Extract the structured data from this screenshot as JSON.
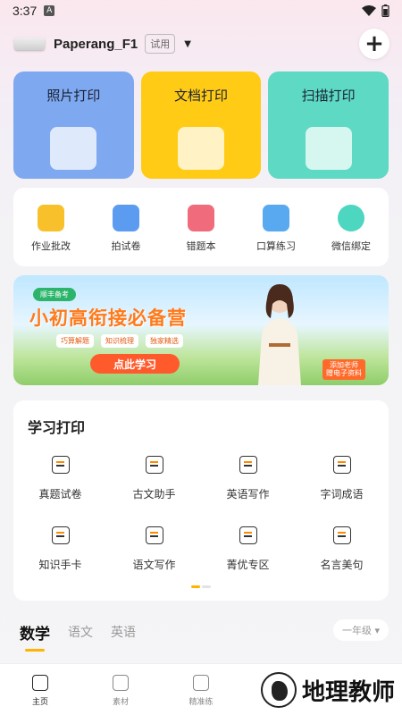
{
  "status_bar": {
    "time": "3:37",
    "notif_letter": "A"
  },
  "header": {
    "device_name": "Paperang_F1",
    "trial_badge": "试用",
    "add_label": "+"
  },
  "big_tiles": [
    {
      "label": "照片打印",
      "color": "#7ea8f0"
    },
    {
      "label": "文档打印",
      "color": "#ffcb15"
    },
    {
      "label": "扫描打印",
      "color": "#5dd9c4"
    }
  ],
  "tools": [
    {
      "label": "作业批改",
      "icon": "homework-check-icon",
      "color": "#f8c12c"
    },
    {
      "label": "拍试卷",
      "icon": "photo-exam-icon",
      "color": "#5b9cf0"
    },
    {
      "label": "错题本",
      "icon": "mistake-book-icon",
      "color": "#f06b7c"
    },
    {
      "label": "口算练习",
      "icon": "mental-math-icon",
      "color": "#58a9f0"
    },
    {
      "label": "微信绑定",
      "icon": "wechat-bind-icon",
      "color": "#4dd6c0"
    }
  ],
  "banner": {
    "tag": "顺丰备考",
    "headline": "小初高衔接必备营",
    "chips": [
      "巧算解题",
      "知识梳理",
      "独家精选"
    ],
    "cta": "点此学习",
    "promo_line1": "添加老师",
    "promo_line2": "赠电子资料"
  },
  "study": {
    "title": "学习打印",
    "items": [
      {
        "label": "真题试卷",
        "icon": "exam-paper-icon"
      },
      {
        "label": "古文助手",
        "icon": "classical-text-icon"
      },
      {
        "label": "英语写作",
        "icon": "english-writing-icon"
      },
      {
        "label": "字词成语",
        "icon": "idiom-book-icon"
      },
      {
        "label": "知识手卡",
        "icon": "knowledge-card-icon"
      },
      {
        "label": "语文写作",
        "icon": "chinese-writing-icon"
      },
      {
        "label": "菁优专区",
        "icon": "jingyou-zone-icon"
      },
      {
        "label": "名言美句",
        "icon": "quotes-icon"
      }
    ]
  },
  "subjects": {
    "tabs": [
      "数学",
      "语文",
      "英语"
    ],
    "active_index": 0,
    "grade": "一年级"
  },
  "bottom_nav": [
    {
      "label": "主页",
      "icon": "home-icon"
    },
    {
      "label": "素材",
      "icon": "material-icon"
    },
    {
      "label": "精准练",
      "icon": "practice-icon"
    }
  ],
  "watermark": {
    "text": "地理教师"
  }
}
